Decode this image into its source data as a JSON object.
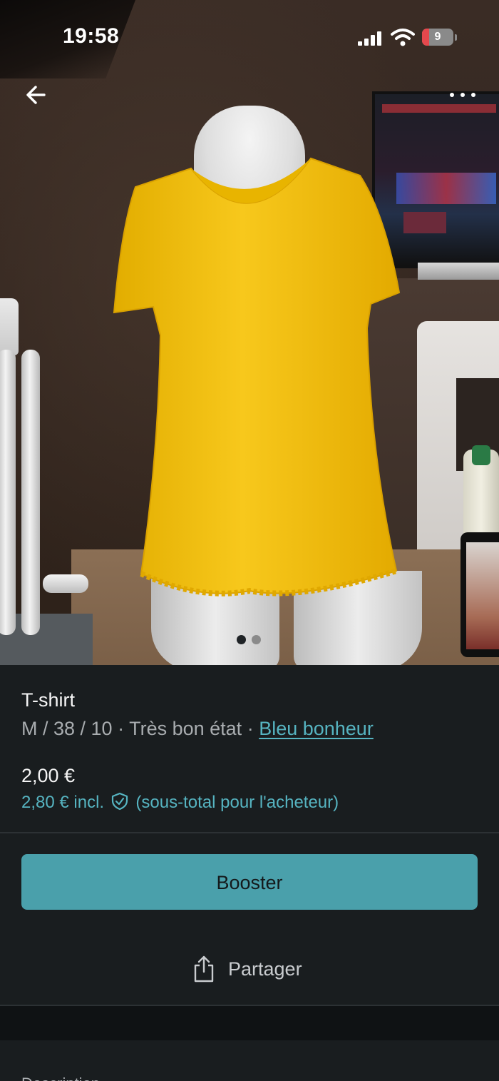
{
  "status_bar": {
    "time": "19:58",
    "battery": "9"
  },
  "icons": {
    "back": "arrow-left-icon",
    "more": "ellipsis-icon",
    "share": "share-icon",
    "buyer_protection": "shield-check-icon"
  },
  "photo": {
    "carousel_count": 2,
    "active_index": 0
  },
  "item": {
    "title": "T-shirt",
    "size": "M / 38 / 10",
    "separator_1": " · ",
    "condition": "Très bon état",
    "separator_2": " · ",
    "brand": "Bleu bonheur",
    "price": "2,00 €",
    "price_incl": "2,80 € incl.",
    "price_incl_note": "(sous-total pour l'acheteur)"
  },
  "actions": {
    "booster_label": "Booster",
    "share_label": "Partager"
  },
  "description": {
    "label": "Description"
  },
  "colors": {
    "accent": "#4aa0ab",
    "link": "#56b4c1",
    "background": "#191d1f",
    "shirt": "#f5c518"
  }
}
